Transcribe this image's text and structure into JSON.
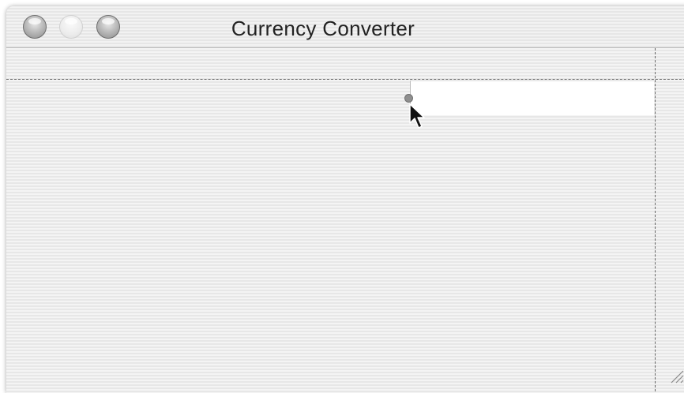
{
  "window": {
    "title": "Currency Converter"
  },
  "text_field": {
    "value": ""
  },
  "icons": {
    "cursor": "arrow-cursor-icon",
    "resize": "resize-grip-icon"
  }
}
